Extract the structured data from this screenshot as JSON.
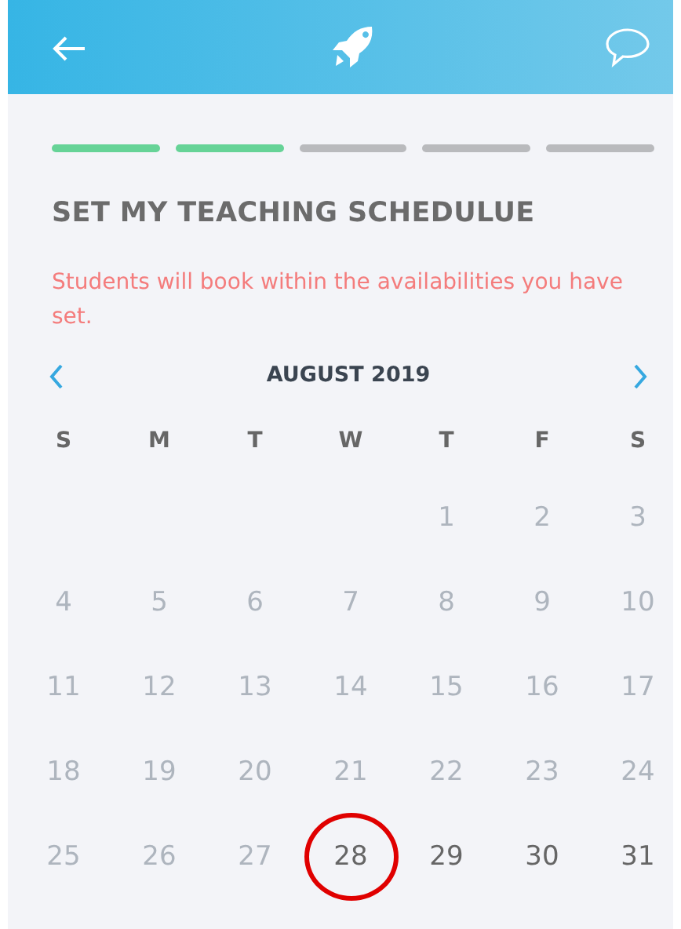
{
  "progress": [
    {
      "done": true
    },
    {
      "done": true
    },
    {
      "done": false
    },
    {
      "done": false
    },
    {
      "done": false
    }
  ],
  "title": "SET MY TEACHING SCHEDULUE",
  "subtitle": "Students will book within the availabilities you have set.",
  "calendar": {
    "month": "AUGUST 2019",
    "weekdays": [
      "S",
      "M",
      "T",
      "W",
      "T",
      "F",
      "S"
    ],
    "weeks": [
      [
        {
          "kind": "blank"
        },
        {
          "kind": "blank"
        },
        {
          "kind": "blank"
        },
        {
          "kind": "blank"
        },
        {
          "kind": "day",
          "label": "1",
          "disabled": true,
          "circled": false
        },
        {
          "kind": "day",
          "label": "2",
          "disabled": true,
          "circled": false
        },
        {
          "kind": "day",
          "label": "3",
          "disabled": true,
          "circled": false
        }
      ],
      [
        {
          "kind": "day",
          "label": "4",
          "disabled": true,
          "circled": false
        },
        {
          "kind": "day",
          "label": "5",
          "disabled": true,
          "circled": false
        },
        {
          "kind": "day",
          "label": "6",
          "disabled": true,
          "circled": false
        },
        {
          "kind": "day",
          "label": "7",
          "disabled": true,
          "circled": false
        },
        {
          "kind": "day",
          "label": "8",
          "disabled": true,
          "circled": false
        },
        {
          "kind": "day",
          "label": "9",
          "disabled": true,
          "circled": false
        },
        {
          "kind": "day",
          "label": "10",
          "disabled": true,
          "circled": false
        }
      ],
      [
        {
          "kind": "day",
          "label": "11",
          "disabled": true,
          "circled": false
        },
        {
          "kind": "day",
          "label": "12",
          "disabled": true,
          "circled": false
        },
        {
          "kind": "day",
          "label": "13",
          "disabled": true,
          "circled": false
        },
        {
          "kind": "day",
          "label": "14",
          "disabled": true,
          "circled": false
        },
        {
          "kind": "day",
          "label": "15",
          "disabled": true,
          "circled": false
        },
        {
          "kind": "day",
          "label": "16",
          "disabled": true,
          "circled": false
        },
        {
          "kind": "day",
          "label": "17",
          "disabled": true,
          "circled": false
        }
      ],
      [
        {
          "kind": "day",
          "label": "18",
          "disabled": true,
          "circled": false
        },
        {
          "kind": "day",
          "label": "19",
          "disabled": true,
          "circled": false
        },
        {
          "kind": "day",
          "label": "20",
          "disabled": true,
          "circled": false
        },
        {
          "kind": "day",
          "label": "21",
          "disabled": true,
          "circled": false
        },
        {
          "kind": "day",
          "label": "22",
          "disabled": true,
          "circled": false
        },
        {
          "kind": "day",
          "label": "23",
          "disabled": true,
          "circled": false
        },
        {
          "kind": "day",
          "label": "24",
          "disabled": true,
          "circled": false
        }
      ],
      [
        {
          "kind": "day",
          "label": "25",
          "disabled": true,
          "circled": false
        },
        {
          "kind": "day",
          "label": "26",
          "disabled": true,
          "circled": false
        },
        {
          "kind": "day",
          "label": "27",
          "disabled": true,
          "circled": false
        },
        {
          "kind": "day",
          "label": "28",
          "disabled": false,
          "circled": true
        },
        {
          "kind": "day",
          "label": "29",
          "disabled": false,
          "circled": false
        },
        {
          "kind": "day",
          "label": "30",
          "disabled": false,
          "circled": false
        },
        {
          "kind": "day",
          "label": "31",
          "disabled": false,
          "circled": false
        }
      ]
    ]
  }
}
